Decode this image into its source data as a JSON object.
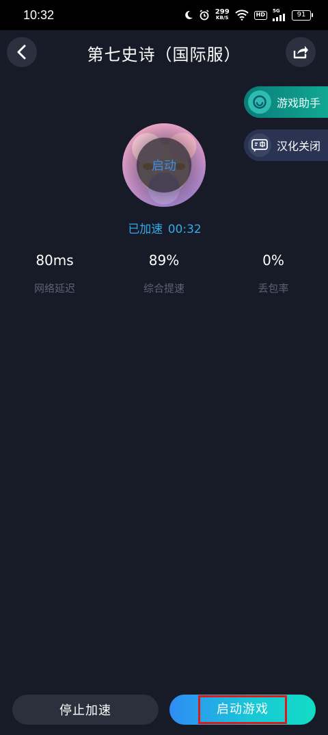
{
  "status_bar": {
    "time": "10:32",
    "net_speed_value": "299",
    "net_speed_unit": "KB/S",
    "hd_label": "HD",
    "signal_label": "5G",
    "battery_level": "91",
    "icons": [
      "moon-icon",
      "alarm-icon",
      "wifi-icon",
      "signal-icon",
      "battery-icon"
    ]
  },
  "header": {
    "title": "第七史诗（国际服）",
    "back_icon": "chevron-left-icon",
    "share_icon": "share-icon"
  },
  "side_actions": {
    "assistant_label": "游戏助手",
    "translate_label": "汉化关闭"
  },
  "game": {
    "avatar_overlay_label": "启动",
    "boost_status_label": "已加速",
    "boost_timer": "00:32"
  },
  "stats": [
    {
      "value": "80ms",
      "label": "网络延迟"
    },
    {
      "value": "89%",
      "label": "综合提速"
    },
    {
      "value": "0%",
      "label": "丢包率"
    }
  ],
  "actions": {
    "stop_label": "停止加速",
    "launch_label": "启动游戏"
  },
  "colors": {
    "background": "#171b27",
    "accent_blue": "#33a9ea",
    "accent_teal": "#12dcc4",
    "highlight_box": "#e01818"
  }
}
